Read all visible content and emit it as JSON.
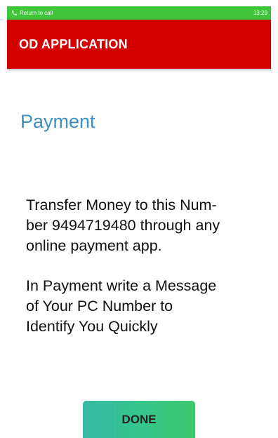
{
  "status_bar": {
    "call_text": "Return to call",
    "time": "13:29",
    "icon": "phone-icon",
    "color": "#3fc43a"
  },
  "app_bar": {
    "title": "OD APPLICATION",
    "color": "#d40000"
  },
  "page": {
    "heading": "Payment",
    "heading_color": "#3d8fc3",
    "paragraph_1_lines": [
      "Transfer Money to this Num-",
      "ber 9494719480 through any",
      "online payment app."
    ],
    "paragraph_2_lines": [
      "In Payment write a Message",
      "of Your PC Number to",
      "Identify You Quickly"
    ]
  },
  "done_button": {
    "label": "DONE",
    "gradient": [
      "#36b9a3",
      "#3cc96c"
    ]
  }
}
